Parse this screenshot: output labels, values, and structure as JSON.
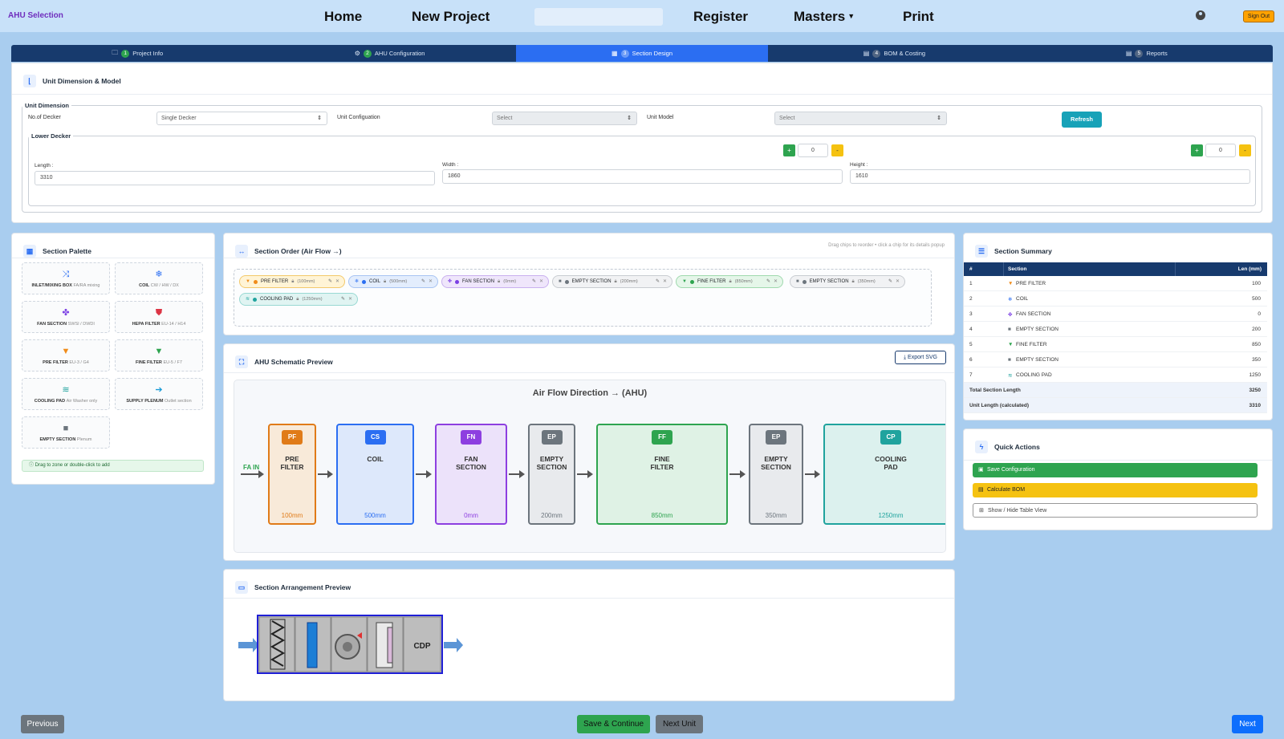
{
  "app": {
    "brand": "AHU Selection"
  },
  "nav": {
    "home": "Home",
    "new_project": "New Project",
    "register": "Register",
    "masters": "Masters",
    "print": "Print",
    "sign_out": "Sign Out"
  },
  "steps": [
    {
      "num": "1",
      "label": "Project Info",
      "icon": "folder-icon"
    },
    {
      "num": "2",
      "label": "AHU Configuration",
      "icon": "gears-icon"
    },
    {
      "num": "3",
      "label": "Section Design",
      "icon": "grid-icon"
    },
    {
      "num": "4",
      "label": "BOM & Costing",
      "icon": "document-icon"
    },
    {
      "num": "5",
      "label": "Reports",
      "icon": "document-icon"
    }
  ],
  "unit": {
    "card_title": "Unit Dimension & Model",
    "fieldset_legend": "Unit Dimension",
    "decker_label": "No.of Decker",
    "decker_value": "Single Decker",
    "config_label": "Unit Configuation",
    "config_value": "Select",
    "model_label": "Unit Model",
    "model_value": "Select",
    "refresh_label": "Refresh",
    "lower_legend": "Lower Decker",
    "stepper1_value": "0",
    "stepper2_value": "0",
    "plus": "+",
    "minus": "-",
    "length_label": "Length :",
    "length_value": "3310",
    "width_label": "Width :",
    "width_value": "1860",
    "height_label": "Height :",
    "height_value": "1610"
  },
  "palette": {
    "title": "Section Palette",
    "items": [
      {
        "name": "INLET/MIXING BOX",
        "sub": "FA/RA mixing",
        "icon": "⤨",
        "color": "#2b6ef2"
      },
      {
        "name": "COIL",
        "sub": "CW / HW / DX",
        "icon": "❄",
        "color": "#2b6ef2"
      },
      {
        "name": "FAN SECTION",
        "sub": "SWSI / DWDI",
        "icon": "✤",
        "color": "#7b3fe4"
      },
      {
        "name": "HEPA FILTER",
        "sub": "EU-14 / H14",
        "icon": "⛊",
        "color": "#dc3545"
      },
      {
        "name": "PRE FILTER",
        "sub": "EU-3 / G4",
        "icon": "▼",
        "color": "#f08c1a"
      },
      {
        "name": "FINE FILTER",
        "sub": "EU-5 / F7",
        "icon": "▼",
        "color": "#2ea44f"
      },
      {
        "name": "COOLING PAD",
        "sub": "Air Washer only",
        "icon": "≋",
        "color": "#20a39e"
      },
      {
        "name": "SUPPLY PLENUM",
        "sub": "Outlet section",
        "icon": "➔",
        "color": "#1a9bd7"
      },
      {
        "name": "EMPTY SECTION",
        "sub": "Plenum",
        "icon": "■",
        "color": "#6c757d"
      }
    ],
    "hint": "Drag to zone or double-click to add"
  },
  "order": {
    "title": "Section Order (Air Flow →)",
    "hint": "Drag chips to reorder • click a chip for its details popup",
    "chips": [
      {
        "label": "PRE FILTER",
        "mm": "(100mm)",
        "icon": "▼",
        "bg": "#fff4d6",
        "border": "#f3c96b",
        "dot": "#f08c1a"
      },
      {
        "label": "COIL",
        "mm": "(500mm)",
        "icon": "❄",
        "bg": "#e3edfd",
        "border": "#a8c4f3",
        "dot": "#2b6ef2"
      },
      {
        "label": "FAN SECTION",
        "mm": "(0mm)",
        "icon": "✤",
        "bg": "#efe6fb",
        "border": "#c9b0ef",
        "dot": "#7b3fe4"
      },
      {
        "label": "EMPTY SECTION",
        "mm": "(200mm)",
        "icon": "■",
        "bg": "#f1f2f4",
        "border": "#c8ccd1",
        "dot": "#6c757d"
      },
      {
        "label": "FINE FILTER",
        "mm": "(850mm)",
        "icon": "▼",
        "bg": "#e5f6e9",
        "border": "#9fd9ae",
        "dot": "#2ea44f"
      },
      {
        "label": "EMPTY SECTION",
        "mm": "(350mm)",
        "icon": "■",
        "bg": "#f1f2f4",
        "border": "#c8ccd1",
        "dot": "#6c757d"
      },
      {
        "label": "COOLING PAD",
        "mm": "(1250mm)",
        "icon": "≋",
        "bg": "#e0f4f2",
        "border": "#99d9d3",
        "dot": "#20a39e"
      }
    ]
  },
  "schematic": {
    "title": "AHU Schematic Preview",
    "export_label": "Export SVG",
    "flow_title": "Air Flow Direction → (AHU)",
    "fa_in": "FA IN",
    "boxes": [
      {
        "code": "PF",
        "name1": "PRE",
        "name2": "FILTER",
        "mm": "100mm",
        "fill": "#f8ead9",
        "border": "#e07b18",
        "badge": "#e07b18",
        "mmc": "#e07b18"
      },
      {
        "code": "CS",
        "name1": "COIL",
        "name2": "",
        "mm": "500mm",
        "fill": "#dde8fb",
        "border": "#2b6ef2",
        "badge": "#2b6ef2",
        "mmc": "#2b6ef2"
      },
      {
        "code": "FN",
        "name1": "FAN",
        "name2": "SECTION",
        "mm": "0mm",
        "fill": "#ece2fa",
        "border": "#8d3fe0",
        "badge": "#8d3fe0",
        "mmc": "#8d3fe0"
      },
      {
        "code": "EP",
        "name1": "EMPTY",
        "name2": "SECTION",
        "mm": "200mm",
        "fill": "#e8eaed",
        "border": "#6c757d",
        "badge": "#6c757d",
        "mmc": "#6c757d"
      },
      {
        "code": "FF",
        "name1": "FINE",
        "name2": "FILTER",
        "mm": "850mm",
        "fill": "#dff2e5",
        "border": "#2ea44f",
        "badge": "#2ea44f",
        "mmc": "#2ea44f"
      },
      {
        "code": "EP",
        "name1": "EMPTY",
        "name2": "SECTION",
        "mm": "350mm",
        "fill": "#e8eaed",
        "border": "#6c757d",
        "badge": "#6c757d",
        "mmc": "#6c757d"
      },
      {
        "code": "CP",
        "name1": "COOLING",
        "name2": "PAD",
        "mm": "1250mm",
        "fill": "#dcf1ee",
        "border": "#20a39e",
        "badge": "#20a39e",
        "mmc": "#20a39e"
      }
    ]
  },
  "arrangement": {
    "title": "Section Arrangement Preview",
    "cdp": "CDP"
  },
  "summary": {
    "title": "Section Summary",
    "headers": [
      "#",
      "Section",
      "Len (mm)"
    ],
    "rows": [
      {
        "n": "1",
        "icon": "▼",
        "color": "#f08c1a",
        "name": "PRE FILTER",
        "len": "100"
      },
      {
        "n": "2",
        "icon": "❄",
        "color": "#2b6ef2",
        "name": "COIL",
        "len": "500"
      },
      {
        "n": "3",
        "icon": "✤",
        "color": "#7b3fe4",
        "name": "FAN SECTION",
        "len": "0"
      },
      {
        "n": "4",
        "icon": "■",
        "color": "#6c757d",
        "name": "EMPTY SECTION",
        "len": "200"
      },
      {
        "n": "5",
        "icon": "▼",
        "color": "#2ea44f",
        "name": "FINE FILTER",
        "len": "850"
      },
      {
        "n": "6",
        "icon": "■",
        "color": "#6c757d",
        "name": "EMPTY SECTION",
        "len": "350"
      },
      {
        "n": "7",
        "icon": "≋",
        "color": "#20a39e",
        "name": "COOLING PAD",
        "len": "1250"
      }
    ],
    "total_label": "Total Section Length",
    "total_value": "3250",
    "unit_label": "Unit Length (calculated)",
    "unit_value": "3310"
  },
  "quick": {
    "title": "Quick Actions",
    "save": "Save Configuration",
    "bom": "Calculate BOM",
    "toggle": "Show / Hide Table View"
  },
  "footer": {
    "previous": "Previous",
    "save_continue": "Save & Continue",
    "next_unit": "Next Unit",
    "next": "Next"
  }
}
